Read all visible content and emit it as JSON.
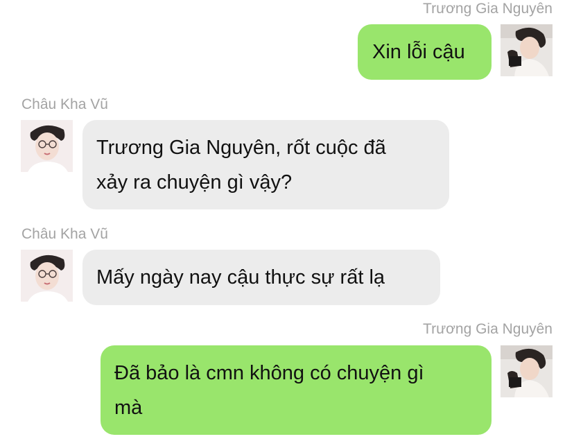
{
  "colors": {
    "background": "#ffffff",
    "outgoing_bubble": "#99e56c",
    "incoming_bubble": "#ececec",
    "sender_name": "#a3a3a3",
    "text": "#111111"
  },
  "messages": [
    {
      "sender": "Trương Gia Nguyên",
      "side": "right",
      "avatar": "avatar-photo",
      "text": "Xin lỗi cậu"
    },
    {
      "sender": "Châu Kha Vũ",
      "side": "left",
      "avatar": "avatar-photo",
      "text_lines": [
        "Trương Gia Nguyên, rốt cuộc đã",
        "xảy ra chuyện gì vậy?"
      ]
    },
    {
      "sender": "Châu Kha Vũ",
      "side": "left",
      "avatar": "avatar-photo",
      "text": "Mấy ngày nay cậu thực sự rất lạ"
    },
    {
      "sender": "Trương Gia Nguyên",
      "side": "right",
      "avatar": "avatar-photo",
      "text_lines": [
        "Đã bảo là cmn không có chuyện gì",
        "mà"
      ]
    }
  ]
}
